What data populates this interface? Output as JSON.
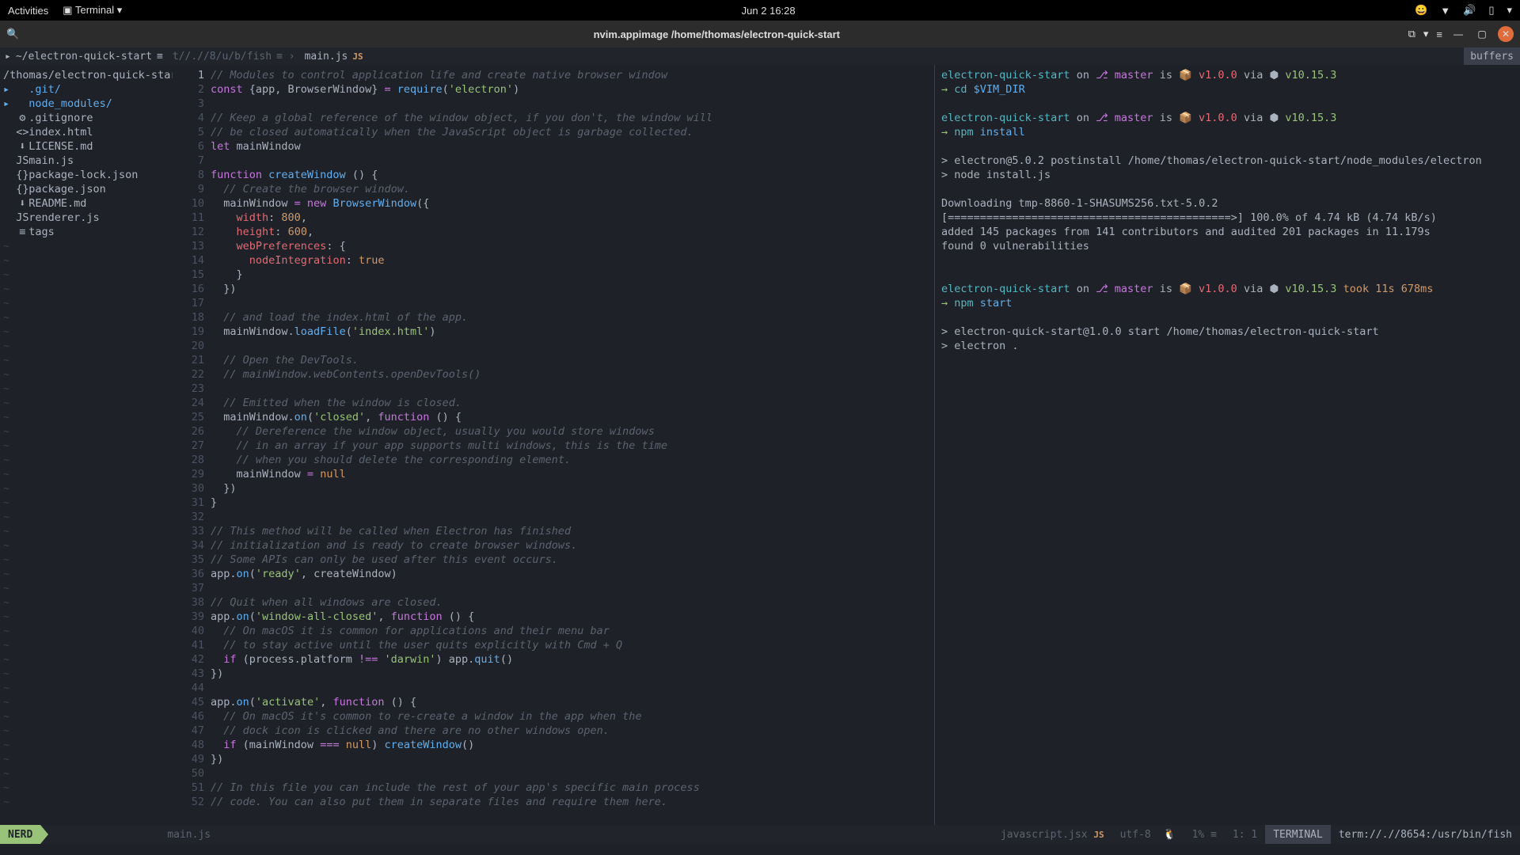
{
  "gnome": {
    "activities": "Activities",
    "app": "Terminal ▾",
    "clock": "Jun 2  16:28"
  },
  "titlebar": {
    "title": "nvim.appimage /home/thomas/electron-quick-start"
  },
  "tabline": {
    "crumb1": "~/electron-quick-start",
    "crumb2": "t//.//8/u/b/fish",
    "crumb3": "main.js",
    "ft_tag": "JS",
    "buffers": "buffers"
  },
  "tree": {
    "root": "/thomas/electron-quick-start/",
    "items": [
      {
        "arrow": "▸",
        "icon": "",
        "name": ".git/",
        "cls": "tree-dir"
      },
      {
        "arrow": "▸",
        "icon": "",
        "name": "node_modules/",
        "cls": "tree-dir"
      },
      {
        "arrow": " ",
        "icon": "⚙",
        "name": ".gitignore",
        "cls": "tree-file"
      },
      {
        "arrow": " ",
        "icon": "<>",
        "name": "index.html",
        "cls": "tree-file"
      },
      {
        "arrow": " ",
        "icon": "⬇",
        "name": "LICENSE.md",
        "cls": "tree-file"
      },
      {
        "arrow": " ",
        "icon": "JS",
        "name": "main.js",
        "cls": "tree-file"
      },
      {
        "arrow": " ",
        "icon": "{}",
        "name": "package-lock.json",
        "cls": "tree-file"
      },
      {
        "arrow": " ",
        "icon": "{}",
        "name": "package.json",
        "cls": "tree-file"
      },
      {
        "arrow": " ",
        "icon": "⬇",
        "name": "README.md",
        "cls": "tree-file"
      },
      {
        "arrow": " ",
        "icon": "JS",
        "name": "renderer.js",
        "cls": "tree-file"
      },
      {
        "arrow": " ",
        "icon": "≡",
        "name": "tags",
        "cls": "tree-file"
      }
    ]
  },
  "code": {
    "lines": [
      {
        "n": 1,
        "t": [
          [
            "c-comment",
            "// Modules to control application life and create native browser window"
          ]
        ]
      },
      {
        "n": 2,
        "t": [
          [
            "c-keyword",
            "const "
          ],
          [
            "",
            "{app, BrowserWindow} "
          ],
          [
            "c-keyword",
            "= "
          ],
          [
            "c-func",
            "require"
          ],
          [
            "",
            "("
          ],
          [
            "c-string",
            "'electron'"
          ],
          [
            "",
            ")"
          ]
        ]
      },
      {
        "n": 3,
        "t": []
      },
      {
        "n": 4,
        "t": [
          [
            "c-comment",
            "// Keep a global reference of the window object, if you don't, the window will"
          ]
        ]
      },
      {
        "n": 5,
        "t": [
          [
            "c-comment",
            "// be closed automatically when the JavaScript object is garbage collected."
          ]
        ]
      },
      {
        "n": 6,
        "t": [
          [
            "c-keyword",
            "let "
          ],
          [
            "",
            "mainWindow"
          ]
        ]
      },
      {
        "n": 7,
        "t": []
      },
      {
        "n": 8,
        "t": [
          [
            "c-keyword",
            "function "
          ],
          [
            "c-func",
            "createWindow "
          ],
          [
            "",
            "() {"
          ]
        ]
      },
      {
        "n": 9,
        "t": [
          [
            "",
            "  "
          ],
          [
            "c-comment",
            "// Create the browser window."
          ]
        ]
      },
      {
        "n": 10,
        "t": [
          [
            "",
            "  mainWindow "
          ],
          [
            "c-keyword",
            "= new "
          ],
          [
            "c-func",
            "BrowserWindow"
          ],
          [
            "",
            "({"
          ]
        ]
      },
      {
        "n": 11,
        "t": [
          [
            "",
            "    "
          ],
          [
            "c-ident",
            "width"
          ],
          [
            "",
            ": "
          ],
          [
            "c-num",
            "800"
          ],
          [
            "",
            ","
          ]
        ]
      },
      {
        "n": 12,
        "t": [
          [
            "",
            "    "
          ],
          [
            "c-ident",
            "height"
          ],
          [
            "",
            ": "
          ],
          [
            "c-num",
            "600"
          ],
          [
            "",
            ","
          ]
        ]
      },
      {
        "n": 13,
        "t": [
          [
            "",
            "    "
          ],
          [
            "c-ident",
            "webPreferences"
          ],
          [
            "",
            ": {"
          ]
        ]
      },
      {
        "n": 14,
        "t": [
          [
            "",
            "      "
          ],
          [
            "c-ident",
            "nodeIntegration"
          ],
          [
            "",
            ": "
          ],
          [
            "c-const",
            "true"
          ]
        ]
      },
      {
        "n": 15,
        "t": [
          [
            "",
            "    }"
          ]
        ]
      },
      {
        "n": 16,
        "t": [
          [
            "",
            "  })"
          ]
        ]
      },
      {
        "n": 17,
        "t": []
      },
      {
        "n": 18,
        "t": [
          [
            "",
            "  "
          ],
          [
            "c-comment",
            "// and load the index.html of the app."
          ]
        ]
      },
      {
        "n": 19,
        "t": [
          [
            "",
            "  mainWindow."
          ],
          [
            "c-func",
            "loadFile"
          ],
          [
            "",
            "("
          ],
          [
            "c-string",
            "'index.html'"
          ],
          [
            "",
            ")"
          ]
        ]
      },
      {
        "n": 20,
        "t": []
      },
      {
        "n": 21,
        "t": [
          [
            "",
            "  "
          ],
          [
            "c-comment",
            "// Open the DevTools."
          ]
        ]
      },
      {
        "n": 22,
        "t": [
          [
            "",
            "  "
          ],
          [
            "c-comment",
            "// mainWindow.webContents.openDevTools()"
          ]
        ]
      },
      {
        "n": 23,
        "t": []
      },
      {
        "n": 24,
        "t": [
          [
            "",
            "  "
          ],
          [
            "c-comment",
            "// Emitted when the window is closed."
          ]
        ]
      },
      {
        "n": 25,
        "t": [
          [
            "",
            "  mainWindow."
          ],
          [
            "c-func",
            "on"
          ],
          [
            "",
            "("
          ],
          [
            "c-string",
            "'closed'"
          ],
          [
            "",
            ", "
          ],
          [
            "c-keyword",
            "function "
          ],
          [
            "",
            "() {"
          ]
        ]
      },
      {
        "n": 26,
        "t": [
          [
            "",
            "    "
          ],
          [
            "c-comment",
            "// Dereference the window object, usually you would store windows"
          ]
        ]
      },
      {
        "n": 27,
        "t": [
          [
            "",
            "    "
          ],
          [
            "c-comment",
            "// in an array if your app supports multi windows, this is the time"
          ]
        ]
      },
      {
        "n": 28,
        "t": [
          [
            "",
            "    "
          ],
          [
            "c-comment",
            "// when you should delete the corresponding element."
          ]
        ]
      },
      {
        "n": 29,
        "t": [
          [
            "",
            "    mainWindow "
          ],
          [
            "c-keyword",
            "= "
          ],
          [
            "c-const",
            "null"
          ]
        ]
      },
      {
        "n": 30,
        "t": [
          [
            "",
            "  })"
          ]
        ]
      },
      {
        "n": 31,
        "t": [
          [
            "",
            "}"
          ]
        ]
      },
      {
        "n": 32,
        "t": []
      },
      {
        "n": 33,
        "t": [
          [
            "c-comment",
            "// This method will be called when Electron has finished"
          ]
        ]
      },
      {
        "n": 34,
        "t": [
          [
            "c-comment",
            "// initialization and is ready to create browser windows."
          ]
        ]
      },
      {
        "n": 35,
        "t": [
          [
            "c-comment",
            "// Some APIs can only be used after this event occurs."
          ]
        ]
      },
      {
        "n": 36,
        "t": [
          [
            "",
            "app."
          ],
          [
            "c-func",
            "on"
          ],
          [
            "",
            "("
          ],
          [
            "c-string",
            "'ready'"
          ],
          [
            "",
            ", createWindow)"
          ]
        ]
      },
      {
        "n": 37,
        "t": []
      },
      {
        "n": 38,
        "t": [
          [
            "c-comment",
            "// Quit when all windows are closed."
          ]
        ]
      },
      {
        "n": 39,
        "t": [
          [
            "",
            "app."
          ],
          [
            "c-func",
            "on"
          ],
          [
            "",
            "("
          ],
          [
            "c-string",
            "'window-all-closed'"
          ],
          [
            "",
            ", "
          ],
          [
            "c-keyword",
            "function "
          ],
          [
            "",
            "() {"
          ]
        ]
      },
      {
        "n": 40,
        "t": [
          [
            "",
            "  "
          ],
          [
            "c-comment",
            "// On macOS it is common for applications and their menu bar"
          ]
        ]
      },
      {
        "n": 41,
        "t": [
          [
            "",
            "  "
          ],
          [
            "c-comment",
            "// to stay active until the user quits explicitly with Cmd + Q"
          ]
        ]
      },
      {
        "n": 42,
        "t": [
          [
            "",
            "  "
          ],
          [
            "c-keyword",
            "if "
          ],
          [
            "",
            "(process.platform "
          ],
          [
            "c-keyword",
            "!== "
          ],
          [
            "c-string",
            "'darwin'"
          ],
          [
            "",
            ") app."
          ],
          [
            "c-func",
            "quit"
          ],
          [
            "",
            "()"
          ]
        ]
      },
      {
        "n": 43,
        "t": [
          [
            "",
            "})"
          ]
        ]
      },
      {
        "n": 44,
        "t": []
      },
      {
        "n": 45,
        "t": [
          [
            "",
            "app."
          ],
          [
            "c-func",
            "on"
          ],
          [
            "",
            "("
          ],
          [
            "c-string",
            "'activate'"
          ],
          [
            "",
            ", "
          ],
          [
            "c-keyword",
            "function "
          ],
          [
            "",
            "() {"
          ]
        ]
      },
      {
        "n": 46,
        "t": [
          [
            "",
            "  "
          ],
          [
            "c-comment",
            "// On macOS it's common to re-create a window in the app when the"
          ]
        ]
      },
      {
        "n": 47,
        "t": [
          [
            "",
            "  "
          ],
          [
            "c-comment",
            "// dock icon is clicked and there are no other windows open."
          ]
        ]
      },
      {
        "n": 48,
        "t": [
          [
            "",
            "  "
          ],
          [
            "c-keyword",
            "if "
          ],
          [
            "",
            "(mainWindow "
          ],
          [
            "c-keyword",
            "=== "
          ],
          [
            "c-const",
            "null"
          ],
          [
            "",
            ") "
          ],
          [
            "c-func",
            "createWindow"
          ],
          [
            "",
            "()"
          ]
        ]
      },
      {
        "n": 49,
        "t": [
          [
            "",
            "})"
          ]
        ]
      },
      {
        "n": 50,
        "t": []
      },
      {
        "n": 51,
        "t": [
          [
            "c-comment",
            "// In this file you can include the rest of your app's specific main process"
          ]
        ]
      },
      {
        "n": 52,
        "t": [
          [
            "c-comment",
            "// code. You can also put them in separate files and require them here."
          ]
        ]
      }
    ]
  },
  "term": {
    "prompts": [
      {
        "dir": "electron-quick-start",
        "branch": "master",
        "ver": "v1.0.0",
        "node": "v10.15.3",
        "took": "",
        "cmd": "cd $VIM_DIR"
      },
      {
        "dir": "electron-quick-start",
        "branch": "master",
        "ver": "v1.0.0",
        "node": "v10.15.3",
        "took": "",
        "cmd": "npm install"
      }
    ],
    "output1": [
      "> electron@5.0.2 postinstall /home/thomas/electron-quick-start/node_modules/electron",
      "> node install.js",
      "",
      "Downloading tmp-8860-1-SHASUMS256.txt-5.0.2",
      "[============================================>] 100.0% of 4.74 kB (4.74 kB/s)",
      "added 145 packages from 141 contributors and audited 201 packages in 11.179s",
      "found 0 vulnerabilities",
      ""
    ],
    "prompt3": {
      "dir": "electron-quick-start",
      "branch": "master",
      "ver": "v1.0.0",
      "node": "v10.15.3",
      "took": "took 11s 678ms",
      "cmd": "npm start"
    },
    "output2": [
      "> electron-quick-start@1.0.0 start /home/thomas/electron-quick-start",
      "> electron .",
      ""
    ]
  },
  "statusline": {
    "mode": "NERD",
    "file": "main.js",
    "ft": "javascript.jsx",
    "ft_tag": "JS",
    "enc": "utf-8",
    "percent": "1%",
    "pos": "1:   1",
    "termlabel": "TERMINAL",
    "termpath": "term://.//8654:/usr/bin/fish"
  }
}
